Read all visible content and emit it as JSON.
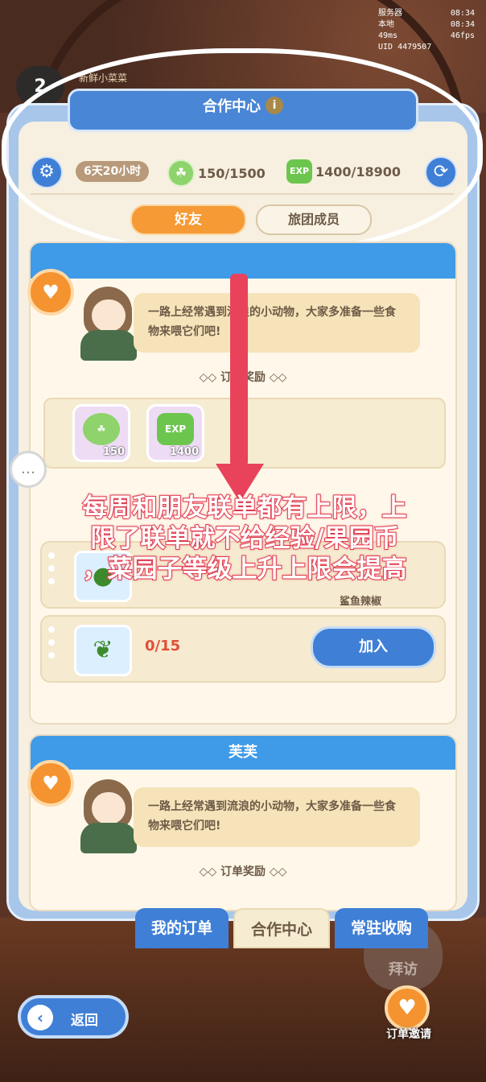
{
  "status": {
    "server_label": "服务器",
    "server_time": "08:34",
    "local_label": "本地",
    "local_time": "08:34",
    "ping": "49ms",
    "fps": "46fps",
    "uid": "UID 4479507"
  },
  "player": {
    "level": "2",
    "name": "新鲜小菜菜"
  },
  "header": {
    "title": "合作中心",
    "info_icon": "info-icon"
  },
  "stats": {
    "timer": "6天20小时",
    "coins": "150/1500",
    "exp_icon_text": "EXP",
    "exp": "1400/18900"
  },
  "tabs": {
    "friends": "好友",
    "guild": "旅团成员"
  },
  "cards": [
    {
      "speech": "一路上经常遇到流浪的小动物，大家多准备一些食物来喂它们吧!",
      "reward_label": "订单奖励",
      "rewards": [
        {
          "icon": "coin",
          "qty": "150"
        },
        {
          "icon": "EXP",
          "qty": "1400"
        }
      ],
      "orders": [
        {
          "item_label": "鲨鱼辣椒"
        },
        {
          "progress": "0/15",
          "join": "加入"
        }
      ]
    },
    {
      "name": "芙芙",
      "speech": "一路上经常遇到流浪的小动物，大家多准备一些食物来喂它们吧!",
      "reward_label": "订单奖励"
    }
  ],
  "annotation": {
    "lines": [
      "每周和朋友联单都有上限，上",
      "限了联单就不给经验/果园币",
      "，菜园子等级上升上限会提高"
    ],
    "color": "#e03a4d"
  },
  "bottom_tabs": {
    "orders": "我的订单",
    "coop": "合作中心",
    "buy": "常驻收购"
  },
  "footer": {
    "back": "返回",
    "invite": "订单邀请",
    "visit": "拜访"
  }
}
